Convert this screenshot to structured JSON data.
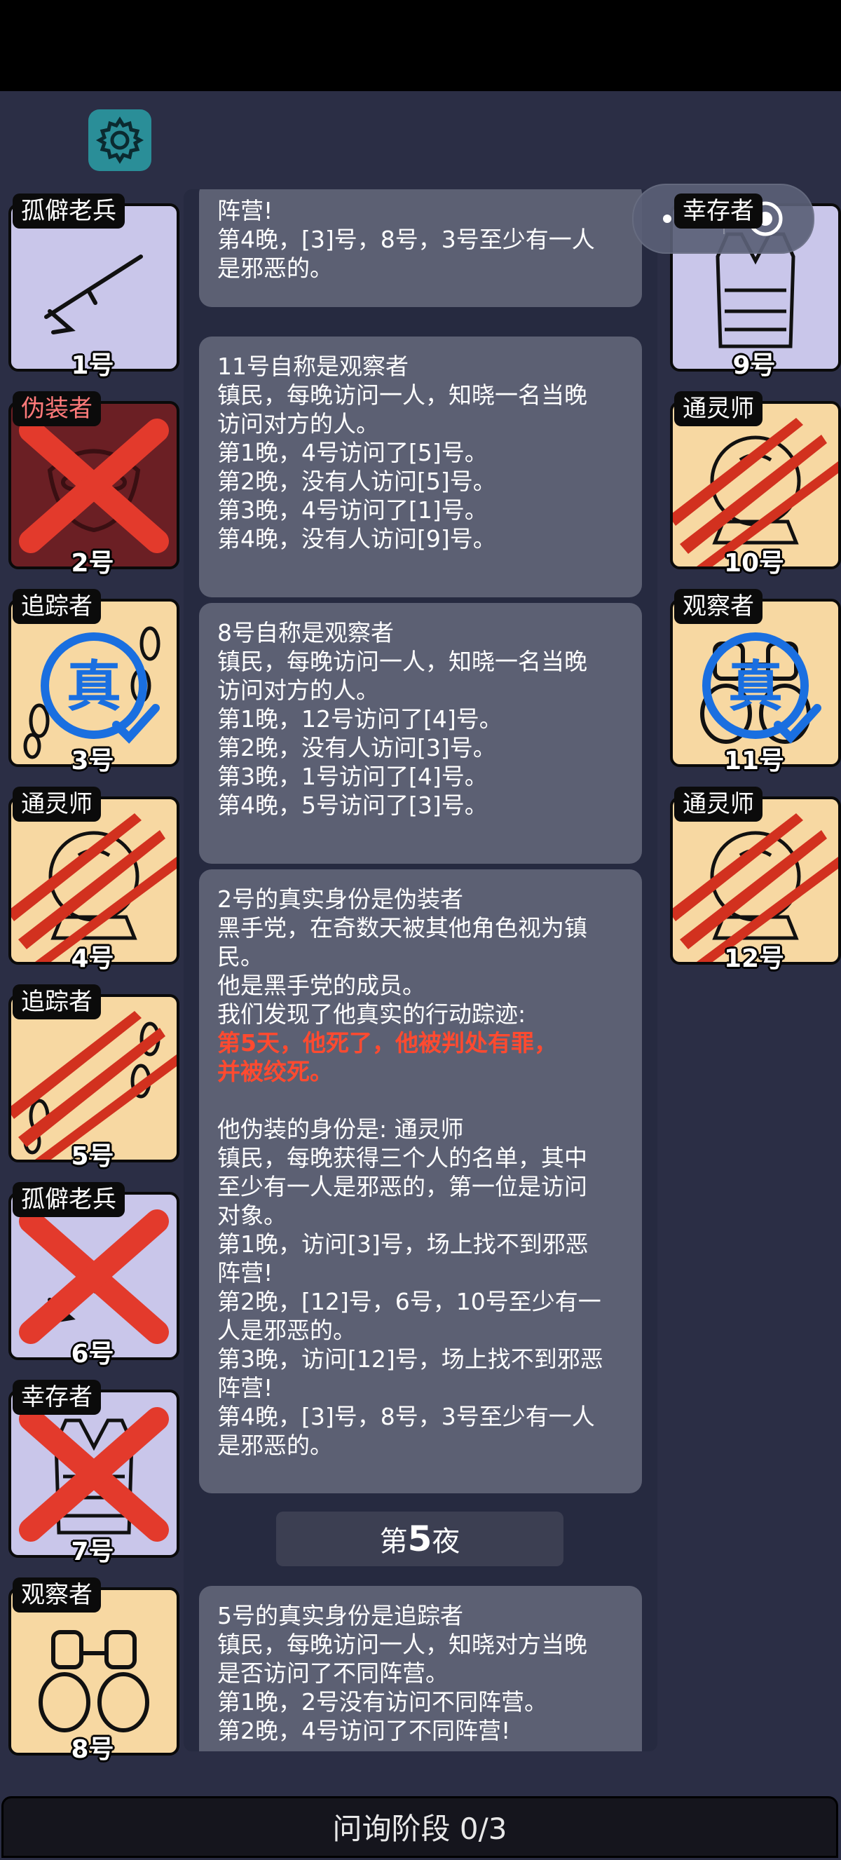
{
  "accent": {
    "gear_bg": "#2a8e98",
    "night_log_red": "#ff4a30",
    "card_tan": "#f7d8a2",
    "card_lavender": "#c9c6ea"
  },
  "left_players": [
    {
      "role": "孤僻老兵",
      "number": "1号",
      "icon": "rifle-icon",
      "dead": false,
      "badge": null
    },
    {
      "role": "伪装者",
      "number": "2号",
      "icon": "mask-icon",
      "dead": true,
      "badge": null
    },
    {
      "role": "追踪者",
      "number": "3号",
      "icon": "footprints-icon",
      "dead": false,
      "badge": "真"
    },
    {
      "role": "通灵师",
      "number": "4号",
      "icon": "crystal-ball-icon",
      "dead": false,
      "badge": "claw-marks"
    },
    {
      "role": "追踪者",
      "number": "5号",
      "icon": "footprints-icon",
      "dead": false,
      "badge": "claw-marks"
    },
    {
      "role": "孤僻老兵",
      "number": "6号",
      "icon": "rifle-icon",
      "dead": true,
      "badge": null
    },
    {
      "role": "幸存者",
      "number": "7号",
      "icon": "vest-icon",
      "dead": true,
      "badge": null
    },
    {
      "role": "观察者",
      "number": "8号",
      "icon": "binoculars-icon",
      "dead": false,
      "badge": null
    }
  ],
  "right_players": [
    {
      "role": "幸存者",
      "number": "9号",
      "icon": "vest-icon",
      "dead": false,
      "badge": null
    },
    {
      "role": "通灵师",
      "number": "10号",
      "icon": "crystal-ball-icon",
      "dead": false,
      "badge": "claw-marks"
    },
    {
      "role": "观察者",
      "number": "11号",
      "icon": "binoculars-icon",
      "dead": false,
      "badge": "真"
    },
    {
      "role": "通灵师",
      "number": "12号",
      "icon": "crystal-ball-icon",
      "dead": false,
      "badge": "claw-marks"
    }
  ],
  "log": {
    "msg1": [
      "阵营!",
      "第4晚，[3]号，8号，3号至少有一人",
      "是邪恶的。"
    ],
    "msg2": [
      "11号自称是观察者",
      "镇民，每晚访问一人，知晓一名当晚",
      "访问对方的人。",
      "第1晚，4号访问了[5]号。",
      "第2晚，没有人访问[5]号。",
      "第3晚，4号访问了[1]号。",
      "第4晚，没有人访问[9]号。"
    ],
    "msg3": [
      "8号自称是观察者",
      "镇民，每晚访问一人，知晓一名当晚",
      "访问对方的人。",
      "第1晚，12号访问了[4]号。",
      "第2晚，没有人访问[3]号。",
      "第3晚，1号访问了[4]号。",
      "第4晚，5号访问了[3]号。"
    ],
    "msg4_top": [
      "2号的真实身份是伪装者",
      "黑手党，在奇数天被其他角色视为镇",
      "民。",
      "他是黑手党的成员。",
      "我们发现了他真实的行动踪迹:"
    ],
    "msg4_red": [
      "第5天，他死了，他被判处有罪，",
      "并被绞死。"
    ],
    "msg4_bottom": [
      "他伪装的身份是: 通灵师",
      "镇民，每晚获得三个人的名单，其中",
      "至少有一人是邪恶的，第一位是访问",
      "对象。",
      "第1晚，访问[3]号，场上找不到邪恶",
      "阵营!",
      "第2晚，[12]号，6号，10号至少有一",
      "人是邪恶的。",
      "第3晚，访问[12]号，场上找不到邪恶",
      "阵营!",
      "第4晚，[3]号，8号，3号至少有一人",
      "是邪恶的。"
    ],
    "night_prefix": "第",
    "night_number": "5",
    "night_suffix": "夜",
    "msg5": [
      "5号的真实身份是追踪者",
      "镇民，每晚访问一人，知晓对方当晚",
      "是否访问了不同阵营。",
      "第1晚，2号没有访问不同阵营。",
      "第2晚，4号访问了不同阵营!"
    ]
  },
  "phase_label": "问询阶段 0/3"
}
